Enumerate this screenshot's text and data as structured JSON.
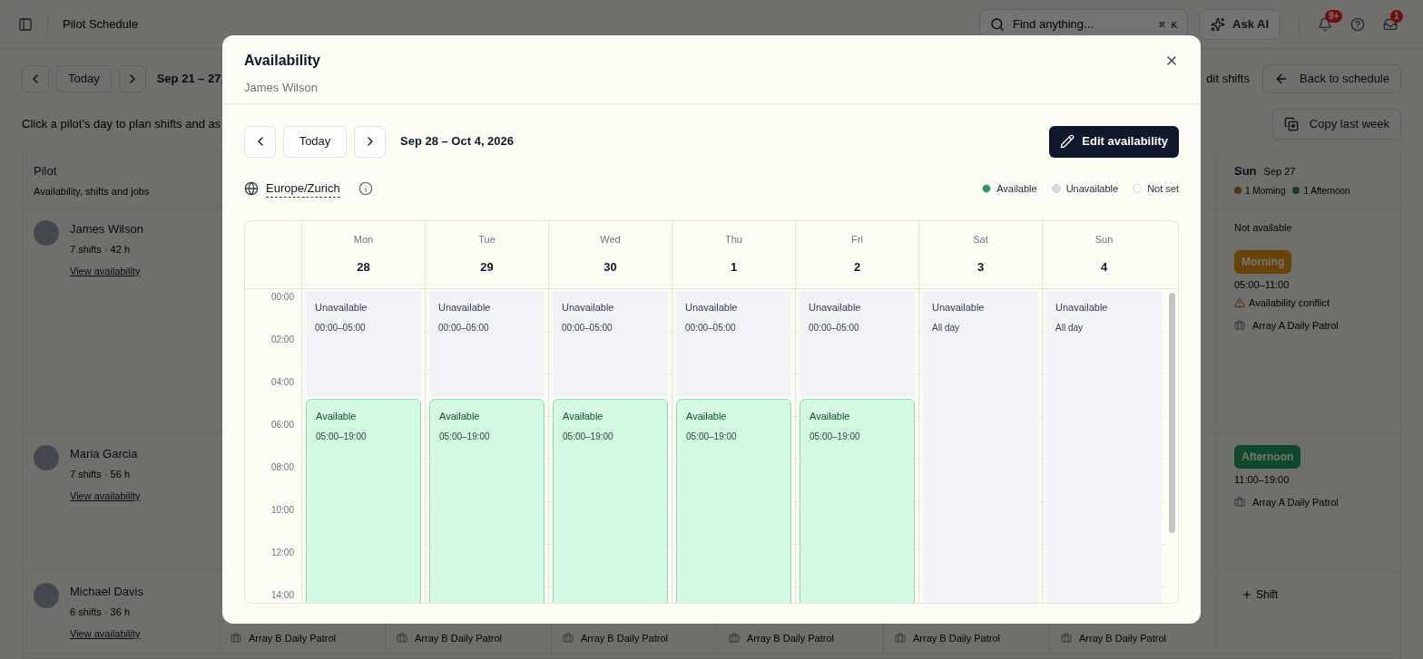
{
  "app_bar": {
    "title": "Pilot Schedule",
    "search": {
      "placeholder": "Find anything...",
      "shortcut": "⌘ K"
    },
    "ask_ai": "Ask AI",
    "notifications_badge": "9+",
    "inbox_badge": "1"
  },
  "toolbar": {
    "today": "Today",
    "range": "Sep 21 – 27,",
    "edit_shifts": "dit shifts",
    "back": "Back to schedule"
  },
  "hint": "Click a pilot's day to plan shifts and as",
  "copy_last_week": "Copy last week",
  "schedule": {
    "pilot_header": {
      "title": "Pilot",
      "subtitle": "Availability, shifts and jobs"
    },
    "sun_header": {
      "day": "Sun",
      "date": "Sep 27",
      "counts": [
        {
          "label": "1 Morning",
          "kind": "morning"
        },
        {
          "label": "1 Afternoon",
          "kind": "afternoon"
        }
      ]
    },
    "pilots": [
      {
        "name": "James Wilson",
        "stats": "7 shifts · 42 h",
        "link": "View availability",
        "sun_cell": {
          "note": "Not available",
          "shifts": [
            {
              "label": "Morning",
              "kind": "morning",
              "time": "05:00–11:00",
              "warning": "Availability conflict",
              "job": "Array A Daily Patrol"
            }
          ]
        }
      },
      {
        "name": "Maria Garcia",
        "stats": "7 shifts · 56 h",
        "link": "View availability",
        "sun_cell": {
          "shifts": [
            {
              "label": "Afternoon",
              "kind": "afternoon",
              "time": "11:00–19:00",
              "job": "Array A Daily Patrol"
            }
          ]
        }
      },
      {
        "name": "Michael Davis",
        "stats": "6 shifts · 36 h",
        "link": "View availability",
        "week_jobs": [
          "Array B Daily Patrol",
          "Array B Daily Patrol",
          "Array B Daily Patrol",
          "Array B Daily Patrol",
          "Array B Daily Patrol",
          "Array B Daily Patrol"
        ],
        "sun_cell": {
          "add_shift": "Shift"
        }
      }
    ]
  },
  "dialog": {
    "title": "Availability",
    "subtitle": "James Wilson",
    "today": "Today",
    "range": "Sep 28 – Oct 4, 2026",
    "edit": "Edit availability",
    "timezone": "Europe/Zurich",
    "legend": [
      {
        "label": "Available",
        "color": "#16a06a"
      },
      {
        "label": "Unavailable",
        "color": "#d6dce6"
      },
      {
        "label": "Not set",
        "color": "#ffffff"
      }
    ],
    "hours": [
      "00:00",
      "02:00",
      "04:00",
      "06:00",
      "08:00",
      "10:00",
      "12:00",
      "14:00"
    ],
    "days": [
      {
        "name": "Mon",
        "date": "28",
        "blocks": [
          {
            "kind": "unavailable",
            "label": "Unavailable",
            "time": "00:00–05:00"
          },
          {
            "kind": "available",
            "label": "Available",
            "time": "05:00–19:00"
          }
        ]
      },
      {
        "name": "Tue",
        "date": "29",
        "blocks": [
          {
            "kind": "unavailable",
            "label": "Unavailable",
            "time": "00:00–05:00"
          },
          {
            "kind": "available",
            "label": "Available",
            "time": "05:00–19:00"
          }
        ]
      },
      {
        "name": "Wed",
        "date": "30",
        "blocks": [
          {
            "kind": "unavailable",
            "label": "Unavailable",
            "time": "00:00–05:00"
          },
          {
            "kind": "available",
            "label": "Available",
            "time": "05:00–19:00"
          }
        ]
      },
      {
        "name": "Thu",
        "date": "1",
        "blocks": [
          {
            "kind": "unavailable",
            "label": "Unavailable",
            "time": "00:00–05:00"
          },
          {
            "kind": "available",
            "label": "Available",
            "time": "05:00–19:00"
          }
        ]
      },
      {
        "name": "Fri",
        "date": "2",
        "blocks": [
          {
            "kind": "unavailable",
            "label": "Unavailable",
            "time": "00:00–05:00"
          },
          {
            "kind": "available",
            "label": "Available",
            "time": "05:00–19:00"
          }
        ]
      },
      {
        "name": "Sat",
        "date": "3",
        "blocks": [
          {
            "kind": "unavailable",
            "label": "Unavailable",
            "time": "All day"
          }
        ]
      },
      {
        "name": "Sun",
        "date": "4",
        "blocks": [
          {
            "kind": "unavailable",
            "label": "Unavailable",
            "time": "All day"
          }
        ]
      }
    ]
  }
}
